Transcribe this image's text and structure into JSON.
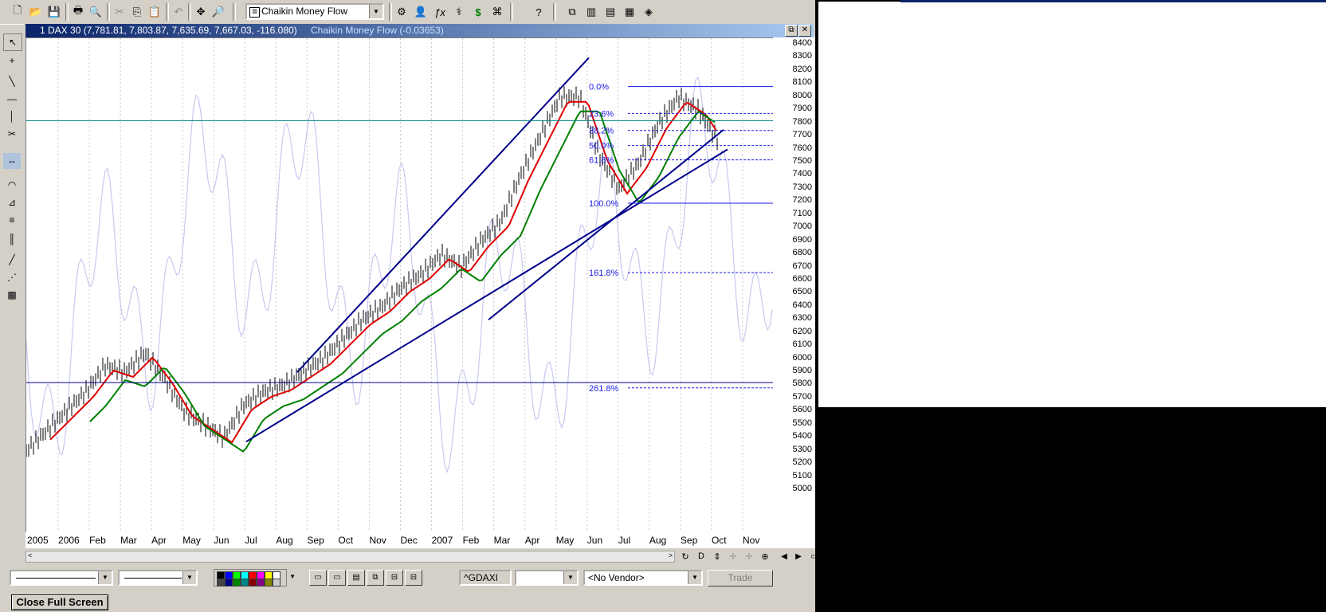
{
  "toolbar": {
    "study_select": "Chaikin Money Flow",
    "icons": [
      "new-icon",
      "open-icon",
      "save-icon",
      "print-icon",
      "print-preview-icon",
      "cut-icon",
      "copy-icon",
      "paste-icon",
      "undo-icon",
      "crosshair-icon",
      "zoom-icon",
      "gear-icon",
      "person-icon",
      "function-icon",
      "indicator-icon",
      "dollar-icon",
      "binoculars-icon",
      "help-icon",
      "window-tile-icon",
      "columns-icon",
      "rows-icon",
      "grid-icon",
      "palette-icon"
    ]
  },
  "chart": {
    "title_main": "1 DAX 30 (7,781.81, 7,803.87, 7,635.69, 7,667.03, -116.080)",
    "title_indicator": "Chaikin Money Flow (-0.03653)",
    "y_ticks": [
      "8400",
      "8300",
      "8200",
      "8100",
      "8000",
      "7900",
      "7800",
      "7700",
      "7600",
      "7500",
      "7400",
      "7300",
      "7200",
      "7100",
      "7000",
      "6900",
      "6800",
      "6700",
      "6600",
      "6500",
      "6400",
      "6300",
      "6200",
      "6100",
      "6000",
      "5900",
      "5800",
      "5700",
      "5600",
      "5500",
      "5400",
      "5300",
      "5200",
      "5100",
      "5000"
    ],
    "x_ticks": [
      "2005",
      "2006",
      "Feb",
      "Mar",
      "Apr",
      "May",
      "Jun",
      "Jul",
      "Aug",
      "Sep",
      "Oct",
      "Nov",
      "Dec",
      "2007",
      "Feb",
      "Mar",
      "Apr",
      "May",
      "Jun",
      "Jul",
      "Aug",
      "Sep",
      "Oct",
      "Nov"
    ],
    "fib_levels": [
      "0.0%",
      "23.6%",
      "38.2%",
      "50.0%",
      "61.8%",
      "100.0%",
      "161.8%",
      "261.8%"
    ],
    "colors": {
      "price": "#000000",
      "ma_fast": "#e00000",
      "ma_slow": "#008000",
      "trend": "#00008b",
      "fib": "#1a1ae6",
      "cmf": "#c8c8f0",
      "hline": "#008080"
    }
  },
  "bottom": {
    "symbol": "^GDAXI",
    "vendor": "<No Vendor>",
    "trade_label": "Trade",
    "close_full_screen": "Close Full Screen"
  },
  "chart_data": {
    "type": "line",
    "series": [
      {
        "name": "DAX 30",
        "values": [
          5300,
          5450,
          5600,
          5750,
          5950,
          5900,
          6050,
          5850,
          5600,
          5500,
          5400,
          5650,
          5750,
          5800,
          5900,
          6000,
          6150,
          6300,
          6400,
          6550,
          6650,
          6800,
          6700,
          6900,
          7050,
          7400,
          7700,
          8000,
          8000,
          7550,
          7300,
          7500,
          7800,
          8000,
          7900,
          7667
        ]
      }
    ],
    "ylim": [
      5000,
      8400
    ]
  }
}
